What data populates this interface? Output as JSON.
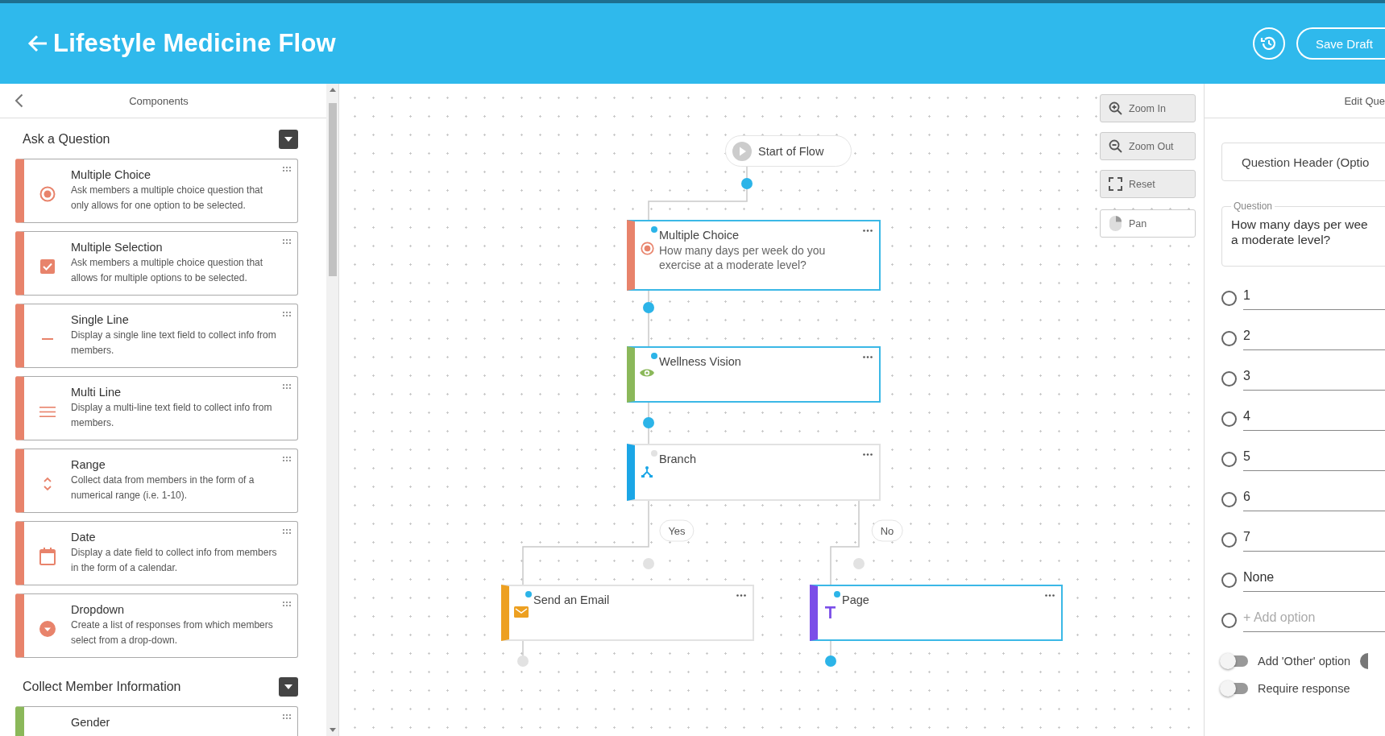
{
  "header": {
    "title": "Lifestyle Medicine Flow",
    "save_button": "Save Draft"
  },
  "components_panel": {
    "title": "Components",
    "sections": [
      {
        "title": "Ask a Question",
        "items": [
          {
            "kind": "radio",
            "title": "Multiple Choice",
            "description": "Ask members a multiple choice question that only allows for one option to be selected.",
            "color": "#e8836b"
          },
          {
            "kind": "checkbox",
            "title": "Multiple Selection",
            "description": "Ask members a multiple choice question that allows for multiple options to be selected.",
            "color": "#e8836b"
          },
          {
            "kind": "single_line",
            "title": "Single Line",
            "description": "Display a single line text field to collect info from members.",
            "color": "#e8836b"
          },
          {
            "kind": "multi_line",
            "title": "Multi Line",
            "description": "Display a multi-line text field to collect info from members.",
            "color": "#e8836b"
          },
          {
            "kind": "range",
            "title": "Range",
            "description": "Collect data from members in the form of a numerical range (i.e. 1-10).",
            "color": "#e8836b"
          },
          {
            "kind": "date",
            "title": "Date",
            "description": "Display a date field to collect info from members in the form of a calendar.",
            "color": "#e8836b"
          },
          {
            "kind": "dropdown",
            "title": "Dropdown",
            "description": "Create a list of responses from which members select from a drop-down.",
            "color": "#e8836b"
          }
        ]
      },
      {
        "title": "Collect Member Information",
        "items": [
          {
            "kind": "gender",
            "title": "Gender",
            "color": "#8bb85a"
          }
        ]
      }
    ]
  },
  "canvas": {
    "start": "Start of Flow",
    "nodes": [
      {
        "kind": "multiple_choice",
        "title": "Multiple Choice",
        "text": "How many days per week do you exercise at a moderate level?",
        "color": "#e8836b",
        "selected": true
      },
      {
        "kind": "vision",
        "title": "Wellness Vision",
        "color": "#8bb85a",
        "selected": true
      },
      {
        "kind": "branch",
        "title": "Branch",
        "color": "#1ba6e6",
        "selected": false
      },
      {
        "kind": "email",
        "title": "Send an Email",
        "color": "#eda021",
        "selected": false
      },
      {
        "kind": "page",
        "title": "Page",
        "color": "#7b4ee8",
        "selected": true
      }
    ],
    "branch_labels": [
      "Yes",
      "No"
    ],
    "controls": [
      {
        "kind": "zoom_in",
        "label": "Zoom In"
      },
      {
        "kind": "zoom_out",
        "label": "Zoom Out"
      },
      {
        "kind": "reset",
        "label": "Reset"
      },
      {
        "kind": "pan",
        "label": "Pan"
      }
    ]
  },
  "editor": {
    "title": "Edit Que",
    "header_placeholder": "Question Header (Optio",
    "question": {
      "label": "Question",
      "lines": [
        "How many days per wee",
        "a moderate level?"
      ]
    },
    "options": [
      {
        "label": "1",
        "selected": false
      },
      {
        "label": "2",
        "selected": false
      },
      {
        "label": "3",
        "selected": false
      },
      {
        "label": "4",
        "selected": false
      },
      {
        "label": "5",
        "selected": false
      },
      {
        "label": "6",
        "selected": false
      },
      {
        "label": "7",
        "selected": false
      },
      {
        "label": "None",
        "selected": false
      }
    ],
    "add_option": {
      "placeholder": "+ Add option",
      "selected": false
    },
    "toggles": [
      {
        "label": "Add 'Other' option",
        "on": false,
        "help": true
      },
      {
        "label": "Require response",
        "on": false,
        "help": false
      }
    ]
  }
}
